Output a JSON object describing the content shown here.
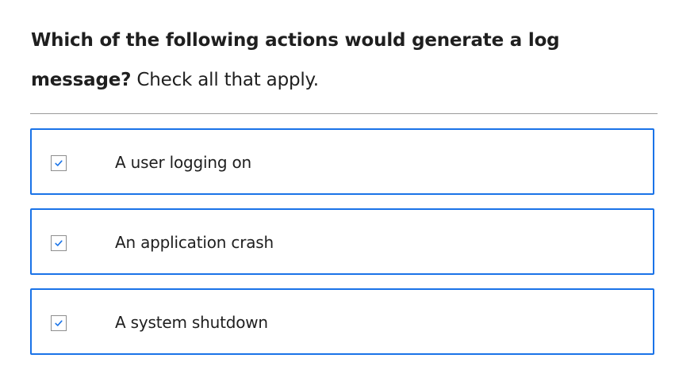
{
  "question": {
    "bold_text": "Which of the following actions would generate a log message?",
    "normal_text": "Check all that apply."
  },
  "options": [
    {
      "label": "A user logging on",
      "checked": true
    },
    {
      "label": "An application crash",
      "checked": true
    },
    {
      "label": "A system shutdown",
      "checked": true
    }
  ],
  "colors": {
    "accent": "#1a73e8",
    "checkmark": "#1a73e8",
    "divider": "#9a9a9a",
    "text": "#1f1f1f"
  },
  "icons": {
    "checkbox": "checkmark-icon"
  }
}
